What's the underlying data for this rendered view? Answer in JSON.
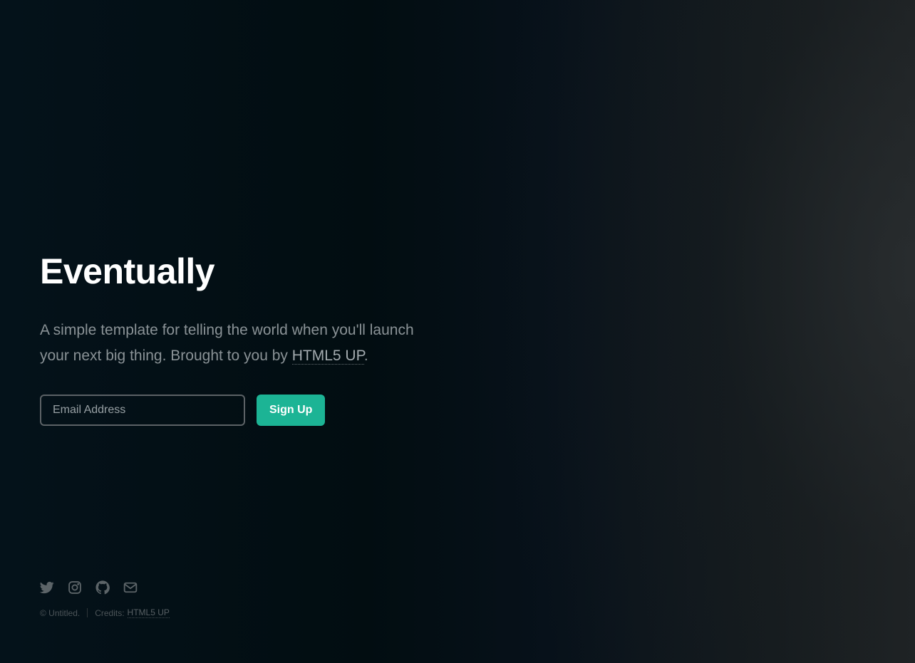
{
  "header": {
    "title": "Eventually"
  },
  "intro": {
    "text_before_link": "A simple template for telling the world when you'll launch your next big thing. Brought to you by ",
    "link_text": "HTML5 UP",
    "text_after_link": "."
  },
  "signup": {
    "email_placeholder": "Email Address",
    "email_value": "",
    "button_label": "Sign Up"
  },
  "footer": {
    "icons": [
      "twitter-icon",
      "instagram-icon",
      "github-icon",
      "email-icon"
    ],
    "copyright": "© Untitled.",
    "credits_label": "Credits:",
    "credits_link": "HTML5 UP"
  },
  "colors": {
    "accent": "#1cb495",
    "background": "#060f12",
    "title": "#ffffff",
    "body_text": "#8a9296"
  }
}
